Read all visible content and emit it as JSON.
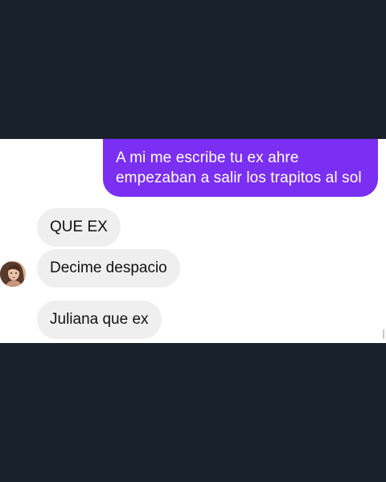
{
  "colors": {
    "background": "#19212b",
    "chat_background": "#ffffff",
    "outgoing_bubble": "#7a2ff2",
    "incoming_bubble": "#efefef"
  },
  "conversation": {
    "outgoing": {
      "line1": "A mi me escribe tu ex ahre",
      "line2": "empezaban a salir los trapitos al sol"
    },
    "incoming": [
      {
        "text": "QUE EX"
      },
      {
        "text": "Decime despacio"
      },
      {
        "text": "Juliana que ex"
      }
    ],
    "avatar_icon": "contact-avatar-photo"
  }
}
